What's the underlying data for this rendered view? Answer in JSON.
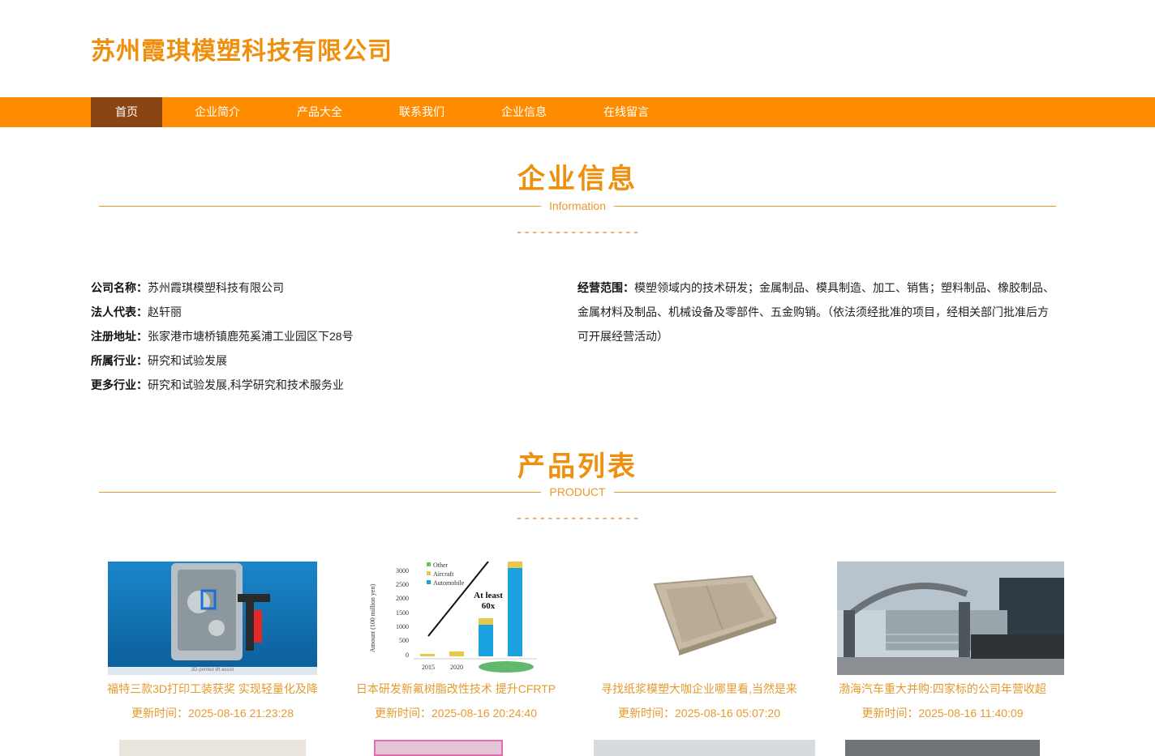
{
  "header": {
    "site_title": "苏州霞琪模塑科技有限公司"
  },
  "nav": {
    "items": [
      {
        "label": "首页",
        "active": true
      },
      {
        "label": "企业简介"
      },
      {
        "label": "产品大全"
      },
      {
        "label": "联系我们"
      },
      {
        "label": "企业信息"
      },
      {
        "label": "在线留言"
      }
    ]
  },
  "company_section": {
    "title": "企业信息",
    "subtitle": "Information",
    "divider": "----------------"
  },
  "company_info": {
    "name_label": "公司名称：",
    "name": "苏州霞琪模塑科技有限公司",
    "legal_label": "法人代表：",
    "legal": "赵轩丽",
    "address_label": "注册地址：",
    "address": "张家港市塘桥镇鹿苑奚浦工业园区下28号",
    "industry_label": "所属行业：",
    "industry": "研究和试验发展",
    "more_label": "更多行业：",
    "more": "研究和试验发展,科学研究和技术服务业",
    "scope_label": "经营范围：",
    "scope": "模塑领域内的技术研发；金属制品、模具制造、加工、销售；塑料制品、橡胶制品、金属材料及制品、机械设备及零部件、五金购销。（依法须经批准的项目，经相关部门批准后方可开展经营活动）"
  },
  "product_section": {
    "title": "产品列表",
    "subtitle": "PRODUCT",
    "divider": "----------------"
  },
  "products": [
    {
      "title": "福特三款3D打印工装获奖 实现轻量化及降",
      "time": "更新时间：2025-08-16 21:23:28",
      "image_caption": "3D-printed lift assist"
    },
    {
      "title": "日本研发新氟树脂改性技术 提升CFRTP",
      "time": "更新时间：2025-08-16 20:24:40",
      "chart": {
        "legend": [
          "Other",
          "Aircraft",
          "Automobile"
        ],
        "yticks": [
          "3000",
          "2500",
          "2000",
          "1500",
          "1000",
          "500",
          "0"
        ],
        "xticks": [
          "2015",
          "2020"
        ],
        "ylabel": "Amount (100 million yen)",
        "annotation": "At least 60x"
      }
    },
    {
      "title": "寻找纸浆模塑大咖企业哪里看,当然是来",
      "time": "更新时间：2025-08-16 05:07:20"
    },
    {
      "title": "渤海汽车重大并购:四家标的公司年营收超",
      "time": "更新时间：2025-08-16 11:40:09"
    }
  ],
  "colors": {
    "accent": "#ee8f0e",
    "nav_bg": "#ff8c00",
    "nav_active": "#8b4513"
  }
}
